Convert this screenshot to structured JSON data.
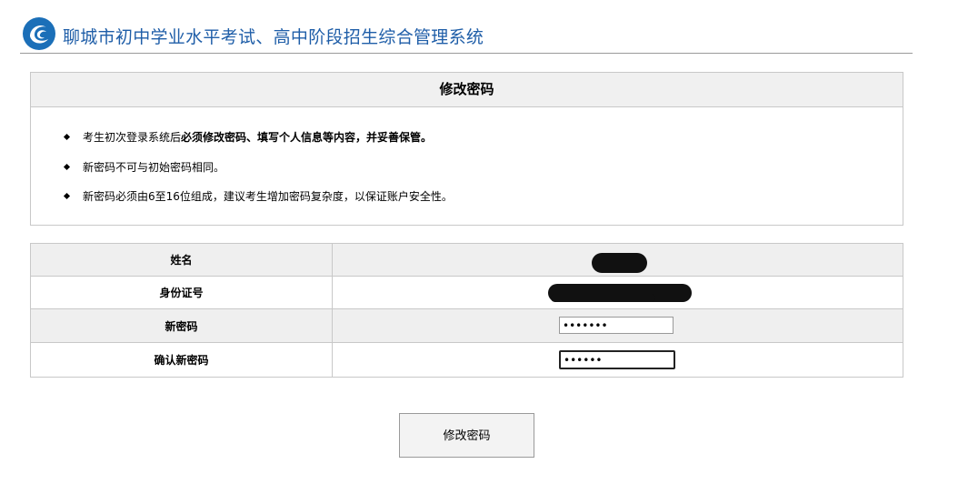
{
  "header": {
    "title": "聊城市初中学业水平考试、高中阶段招生综合管理系统",
    "logo_icon": "swirl-logo-icon",
    "brand_color": "#1f5ea8"
  },
  "notice": {
    "title": "修改密码",
    "items": [
      {
        "prefix": "考生初次登录系统后",
        "bold": "必须修改密码、填写个人信息等内容，并妥善保管。"
      },
      {
        "prefix": "新密码不可与初始密码相同。",
        "bold": ""
      },
      {
        "prefix": "新密码必须由6至16位组成，建议考生增加密码复杂度，以保证账户安全性。",
        "bold": ""
      }
    ]
  },
  "form": {
    "name_label": "姓名",
    "id_label": "身份证号",
    "new_password_label": "新密码",
    "new_password_value": "•••••••",
    "confirm_password_label": "确认新密码",
    "confirm_password_value": "••••••"
  },
  "actions": {
    "submit_label": "修改密码"
  }
}
